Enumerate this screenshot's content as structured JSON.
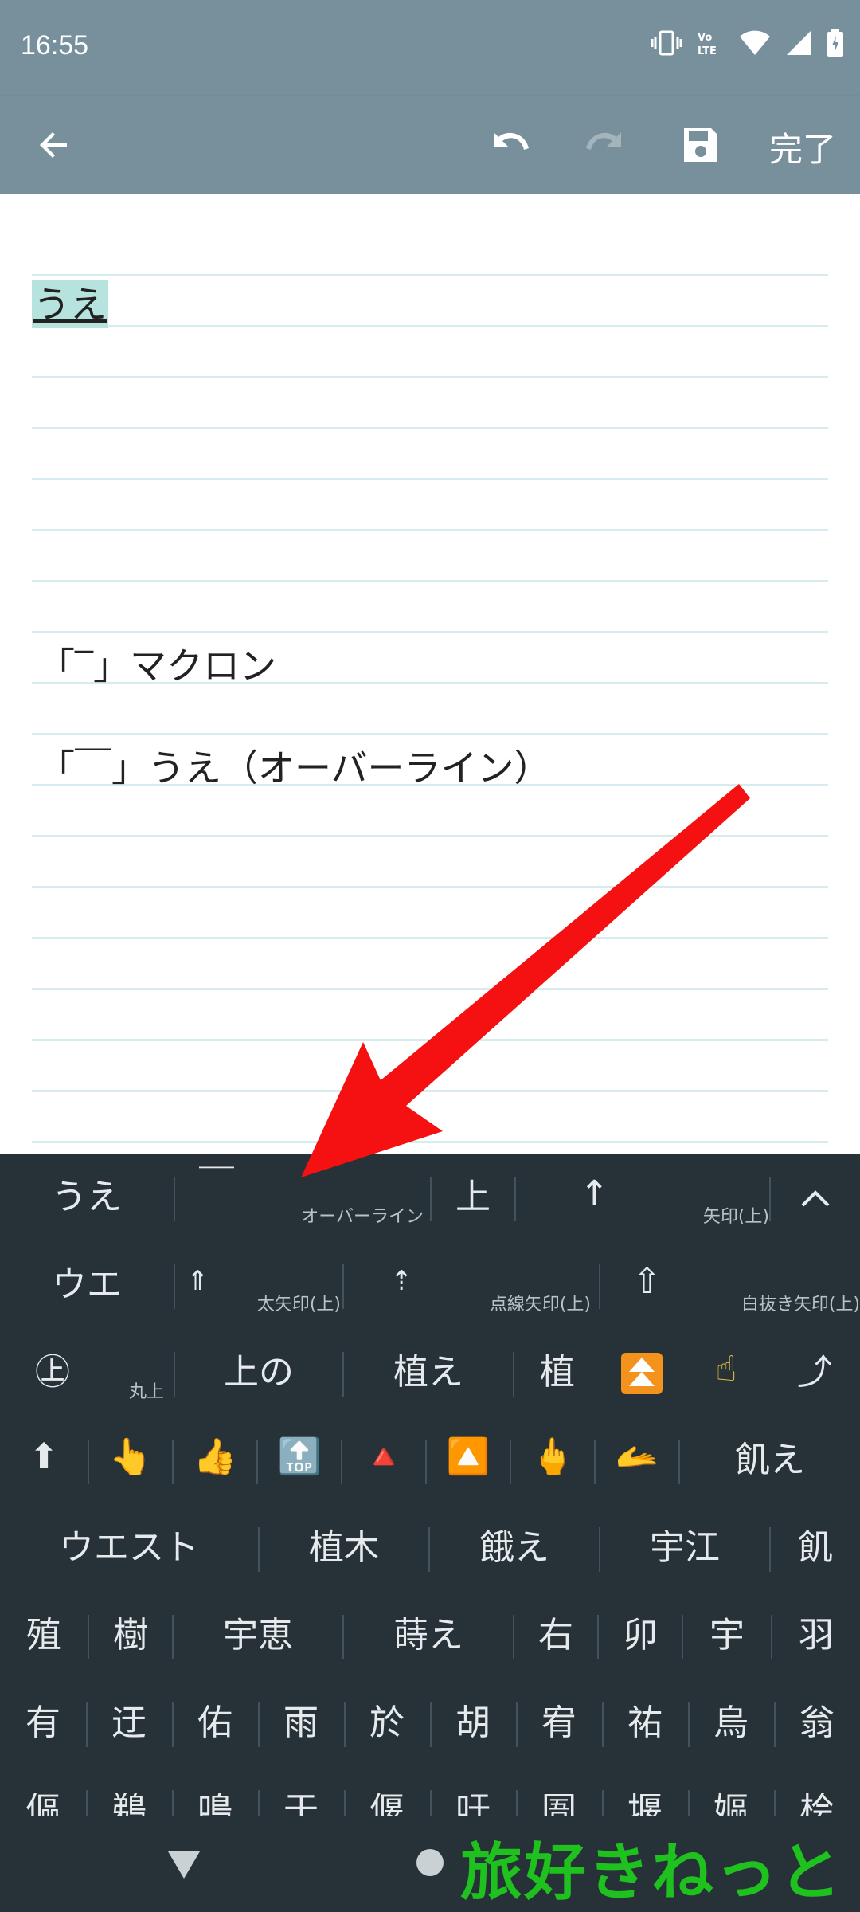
{
  "status_bar": {
    "time": "16:55",
    "icons": [
      "vibrate-icon",
      "volte-icon",
      "wifi-icon",
      "signal-icon",
      "battery-icon"
    ]
  },
  "toolbar": {
    "back_icon": "arrow-left-icon",
    "undo_icon": "undo-icon",
    "redo_icon": "redo-icon",
    "save_icon": "save-icon",
    "done_label": "完了"
  },
  "note": {
    "selected_text": "うえ",
    "lines": [
      "「‾」マクロン",
      "「￣」うえ（オーバーライン）"
    ]
  },
  "keyboard": {
    "rows": [
      [
        {
          "text": "うえ",
          "ann": ""
        },
        {
          "text": "￣",
          "ann": "オーバーライン"
        },
        {
          "text": "上",
          "ann": ""
        },
        {
          "text": "↑",
          "ann": "矢印(上)"
        },
        {
          "text": "⌃",
          "ann": ""
        }
      ],
      [
        {
          "text": "ウエ",
          "ann": ""
        },
        {
          "text": "⇑",
          "ann": "太矢印(上)"
        },
        {
          "text": "⇡",
          "ann": "点線矢印(上)"
        },
        {
          "text": "⇧",
          "ann": "白抜き矢印(上)"
        }
      ],
      [
        {
          "text": "㊤",
          "ann": "丸上"
        },
        {
          "text": "上の",
          "ann": ""
        },
        {
          "text": "植え",
          "ann": ""
        },
        {
          "text": "植",
          "ann": ""
        },
        {
          "text": "⏫",
          "ann": ""
        },
        {
          "text": "☝",
          "ann": ""
        },
        {
          "text": "⤴",
          "ann": ""
        }
      ],
      [
        {
          "text": "⬆",
          "ann": ""
        },
        {
          "text": "👆",
          "ann": ""
        },
        {
          "text": "👍",
          "ann": ""
        },
        {
          "text": "🔝",
          "ann": ""
        },
        {
          "text": "🔺",
          "ann": ""
        },
        {
          "text": "🔼",
          "ann": ""
        },
        {
          "text": "🖕",
          "ann": ""
        },
        {
          "text": "🫴",
          "ann": ""
        },
        {
          "text": "飢え",
          "ann": ""
        }
      ],
      [
        {
          "text": "ウエスト",
          "ann": ""
        },
        {
          "text": "植木",
          "ann": ""
        },
        {
          "text": "餓え",
          "ann": ""
        },
        {
          "text": "宇江",
          "ann": ""
        },
        {
          "text": "飢",
          "ann": ""
        }
      ],
      [
        {
          "text": "殖",
          "ann": ""
        },
        {
          "text": "樹",
          "ann": ""
        },
        {
          "text": "宇恵",
          "ann": ""
        },
        {
          "text": "蒔え",
          "ann": ""
        },
        {
          "text": "右",
          "ann": ""
        },
        {
          "text": "卯",
          "ann": ""
        },
        {
          "text": "宇",
          "ann": ""
        },
        {
          "text": "羽",
          "ann": ""
        }
      ],
      [
        {
          "text": "有",
          "ann": ""
        },
        {
          "text": "迂",
          "ann": ""
        },
        {
          "text": "佑",
          "ann": ""
        },
        {
          "text": "雨",
          "ann": ""
        },
        {
          "text": "於",
          "ann": ""
        },
        {
          "text": "胡",
          "ann": ""
        },
        {
          "text": "宥",
          "ann": ""
        },
        {
          "text": "祐",
          "ann": ""
        },
        {
          "text": "烏",
          "ann": ""
        },
        {
          "text": "翁",
          "ann": ""
        }
      ],
      [
        {
          "text": "傴",
          "ann": ""
        },
        {
          "text": "鵜",
          "ann": ""
        },
        {
          "text": "鳴",
          "ann": ""
        },
        {
          "text": "于",
          "ann": ""
        },
        {
          "text": "偃",
          "ann": ""
        },
        {
          "text": "吁",
          "ann": ""
        },
        {
          "text": "圄",
          "ann": ""
        },
        {
          "text": "堰",
          "ann": ""
        },
        {
          "text": "嫗",
          "ann": ""
        },
        {
          "text": "桧",
          "ann": ""
        }
      ]
    ]
  },
  "navbar": {
    "back_icon": "triangle-down-icon",
    "home_icon": "circle-home-icon"
  },
  "watermark": "旅好きねっと",
  "colors": {
    "toolbar": "#77909b",
    "keyboard_bg": "#263238",
    "selection": "#b7e3df",
    "rule_line": "#d6ecef",
    "arrow": "#f51111",
    "watermark": "#1fc11f"
  }
}
